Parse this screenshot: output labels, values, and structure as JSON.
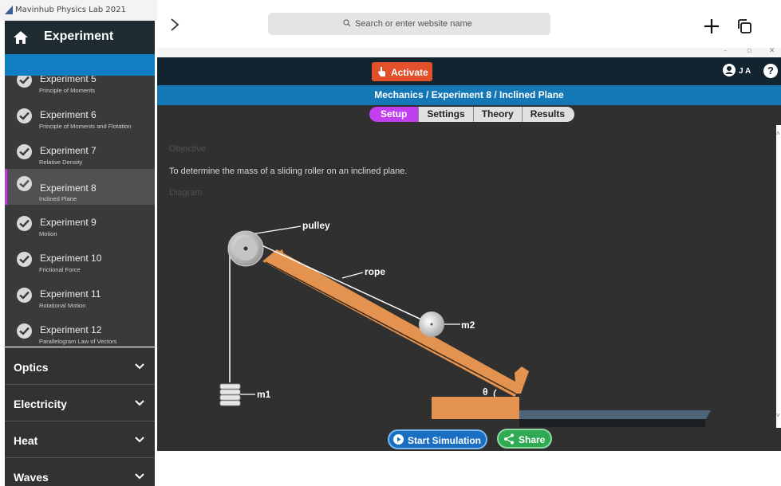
{
  "window": {
    "title": "Mavinhub Physics Lab 2021"
  },
  "sidebar": {
    "header": "Experiment",
    "items": [
      {
        "label": "Experiment 5",
        "sub": "Principle of Moments"
      },
      {
        "label": "Experiment 6",
        "sub": "Principle of Moments and Flotation"
      },
      {
        "label": "Experiment 7",
        "sub": "Relative Density"
      },
      {
        "label": "Experiment 8",
        "sub": "Inclined Plane",
        "active": true
      },
      {
        "label": "Experiment 9",
        "sub": "Motion"
      },
      {
        "label": "Experiment 10",
        "sub": "Frictional Force"
      },
      {
        "label": "Experiment 11",
        "sub": "Rotational Motion"
      },
      {
        "label": "Experiment 12",
        "sub": "Parallelogram Law of Vectors"
      }
    ],
    "sections": [
      "Optics",
      "Electricity",
      "Heat",
      "Waves"
    ]
  },
  "browser": {
    "search_placeholder": "Search or enter website name"
  },
  "app": {
    "activate_label": "Activate",
    "user_initials": "J A",
    "help_label": "?",
    "breadcrumb": "Mechanics / Experiment 8 / Inclined Plane",
    "tabs": [
      "Setup",
      "Settings",
      "Theory",
      "Results"
    ],
    "active_tab": "Setup",
    "objective_heading": "Objective",
    "objective_text": "To determine the mass of a sliding roller on an inclined plane.",
    "diagram_heading": "Diagram",
    "diagram_labels": {
      "pulley": "pulley",
      "rope": "rope",
      "m2": "m2",
      "m1": "m1",
      "theta": "θ"
    },
    "start_simulation_label": "Start Simulation",
    "share_label": "Share"
  },
  "colors": {
    "accent_purple": "#c23ff0",
    "activate_orange": "#e2502c",
    "breadcrumb_blue": "#1478b6",
    "plank_orange": "#e3924f",
    "share_green": "#2faa53",
    "sim_blue": "#1a6fc2"
  }
}
